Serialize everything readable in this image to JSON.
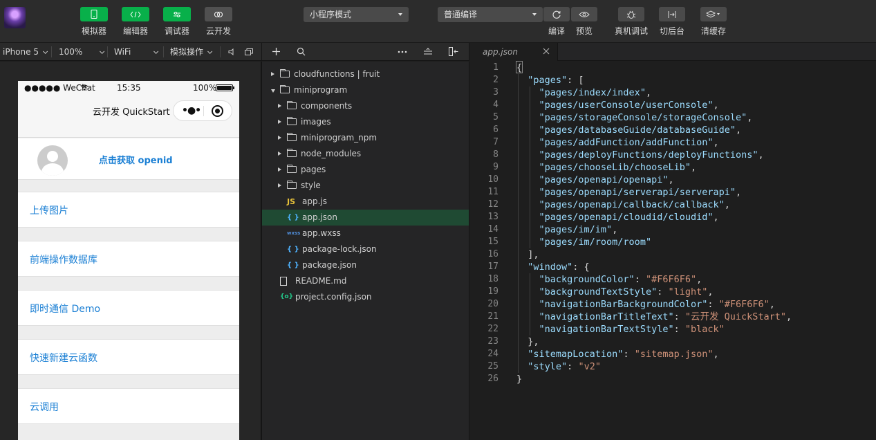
{
  "toolbar": {
    "buttons": [
      {
        "label": "模拟器",
        "icon": "phone-icon"
      },
      {
        "label": "编辑器",
        "icon": "code-icon"
      },
      {
        "label": "调试器",
        "icon": "sliders-icon"
      },
      {
        "label": "云开发",
        "icon": "cloud-icon"
      }
    ],
    "mode_select": "小程序模式",
    "compile_select": "普通编译",
    "actions": [
      {
        "label": "编译",
        "icon": "refresh-icon"
      },
      {
        "label": "预览",
        "icon": "eye-icon"
      },
      {
        "label": "真机调试",
        "icon": "bug-icon"
      },
      {
        "label": "切后台",
        "icon": "switch-icon"
      },
      {
        "label": "清缓存",
        "icon": "layers-icon"
      }
    ]
  },
  "simbar": {
    "device": "iPhone 5",
    "zoom": "100%",
    "network": "WiFi",
    "simulate": "模拟操作"
  },
  "tab": {
    "name": "app.json"
  },
  "phone": {
    "carrier": "●●●●● WeChat",
    "time": "15:35",
    "battery": "100%",
    "nav_title": "云开发 QuickStart",
    "openid_label": "点击获取 openid",
    "menu": [
      "上传图片",
      "前端操作数据库",
      "即时通信 Demo",
      "快速新建云函数",
      "云调用"
    ]
  },
  "tree": [
    {
      "label": "cloudfunctions | fruit",
      "kind": "folder",
      "open": false,
      "depth": 0
    },
    {
      "label": "miniprogram",
      "kind": "folder",
      "open": true,
      "depth": 0
    },
    {
      "label": "components",
      "kind": "folder",
      "open": false,
      "depth": 1
    },
    {
      "label": "images",
      "kind": "folder",
      "open": false,
      "depth": 1
    },
    {
      "label": "miniprogram_npm",
      "kind": "folder",
      "open": false,
      "depth": 1
    },
    {
      "label": "node_modules",
      "kind": "folder",
      "open": false,
      "depth": 1
    },
    {
      "label": "pages",
      "kind": "folder",
      "open": false,
      "depth": 1
    },
    {
      "label": "style",
      "kind": "folder",
      "open": false,
      "depth": 1
    },
    {
      "label": "app.js",
      "kind": "js",
      "depth": 1
    },
    {
      "label": "app.json",
      "kind": "json",
      "depth": 1,
      "selected": true
    },
    {
      "label": "app.wxss",
      "kind": "wxss",
      "depth": 1
    },
    {
      "label": "package-lock.json",
      "kind": "json",
      "depth": 1
    },
    {
      "label": "package.json",
      "kind": "json",
      "depth": 1
    },
    {
      "label": "README.md",
      "kind": "md",
      "depth": 0
    },
    {
      "label": "project.config.json",
      "kind": "config",
      "depth": 0
    }
  ],
  "code_lines": [
    [
      [
        "p",
        "{"
      ]
    ],
    [
      [
        "p",
        "  "
      ],
      [
        "k",
        "\"pages\""
      ],
      [
        "p",
        ": ["
      ]
    ],
    [
      [
        "p",
        "    "
      ],
      [
        "k",
        "\"pages/index/index\""
      ],
      [
        "p",
        ","
      ]
    ],
    [
      [
        "p",
        "    "
      ],
      [
        "k",
        "\"pages/userConsole/userConsole\""
      ],
      [
        "p",
        ","
      ]
    ],
    [
      [
        "p",
        "    "
      ],
      [
        "k",
        "\"pages/storageConsole/storageConsole\""
      ],
      [
        "p",
        ","
      ]
    ],
    [
      [
        "p",
        "    "
      ],
      [
        "k",
        "\"pages/databaseGuide/databaseGuide\""
      ],
      [
        "p",
        ","
      ]
    ],
    [
      [
        "p",
        "    "
      ],
      [
        "k",
        "\"pages/addFunction/addFunction\""
      ],
      [
        "p",
        ","
      ]
    ],
    [
      [
        "p",
        "    "
      ],
      [
        "k",
        "\"pages/deployFunctions/deployFunctions\""
      ],
      [
        "p",
        ","
      ]
    ],
    [
      [
        "p",
        "    "
      ],
      [
        "k",
        "\"pages/chooseLib/chooseLib\""
      ],
      [
        "p",
        ","
      ]
    ],
    [
      [
        "p",
        "    "
      ],
      [
        "k",
        "\"pages/openapi/openapi\""
      ],
      [
        "p",
        ","
      ]
    ],
    [
      [
        "p",
        "    "
      ],
      [
        "k",
        "\"pages/openapi/serverapi/serverapi\""
      ],
      [
        "p",
        ","
      ]
    ],
    [
      [
        "p",
        "    "
      ],
      [
        "k",
        "\"pages/openapi/callback/callback\""
      ],
      [
        "p",
        ","
      ]
    ],
    [
      [
        "p",
        "    "
      ],
      [
        "k",
        "\"pages/openapi/cloudid/cloudid\""
      ],
      [
        "p",
        ","
      ]
    ],
    [
      [
        "p",
        "    "
      ],
      [
        "k",
        "\"pages/im/im\""
      ],
      [
        "p",
        ","
      ]
    ],
    [
      [
        "p",
        "    "
      ],
      [
        "k",
        "\"pages/im/room/room\""
      ]
    ],
    [
      [
        "p",
        "  ],"
      ]
    ],
    [
      [
        "p",
        "  "
      ],
      [
        "k",
        "\"window\""
      ],
      [
        "p",
        ": {"
      ]
    ],
    [
      [
        "p",
        "    "
      ],
      [
        "k",
        "\"backgroundColor\""
      ],
      [
        "p",
        ": "
      ],
      [
        "s",
        "\"#F6F6F6\""
      ],
      [
        "p",
        ","
      ]
    ],
    [
      [
        "p",
        "    "
      ],
      [
        "k",
        "\"backgroundTextStyle\""
      ],
      [
        "p",
        ": "
      ],
      [
        "s",
        "\"light\""
      ],
      [
        "p",
        ","
      ]
    ],
    [
      [
        "p",
        "    "
      ],
      [
        "k",
        "\"navigationBarBackgroundColor\""
      ],
      [
        "p",
        ": "
      ],
      [
        "s",
        "\"#F6F6F6\""
      ],
      [
        "p",
        ","
      ]
    ],
    [
      [
        "p",
        "    "
      ],
      [
        "k",
        "\"navigationBarTitleText\""
      ],
      [
        "p",
        ": "
      ],
      [
        "s",
        "\"云开发 QuickStart\""
      ],
      [
        "p",
        ","
      ]
    ],
    [
      [
        "p",
        "    "
      ],
      [
        "k",
        "\"navigationBarTextStyle\""
      ],
      [
        "p",
        ": "
      ],
      [
        "s",
        "\"black\""
      ]
    ],
    [
      [
        "p",
        "  },"
      ]
    ],
    [
      [
        "p",
        "  "
      ],
      [
        "k",
        "\"sitemapLocation\""
      ],
      [
        "p",
        ": "
      ],
      [
        "s",
        "\"sitemap.json\""
      ],
      [
        "p",
        ","
      ]
    ],
    [
      [
        "p",
        "  "
      ],
      [
        "k",
        "\"style\""
      ],
      [
        "p",
        ": "
      ],
      [
        "s",
        "\"v2\""
      ]
    ],
    [
      [
        "p",
        "}"
      ]
    ]
  ],
  "colors": {
    "accent_green": "#08b04a",
    "link_blue": "#1a7fd4",
    "json_key": "#9cdcfe",
    "json_string": "#ce9178",
    "selected_row": "#1f4a33"
  }
}
